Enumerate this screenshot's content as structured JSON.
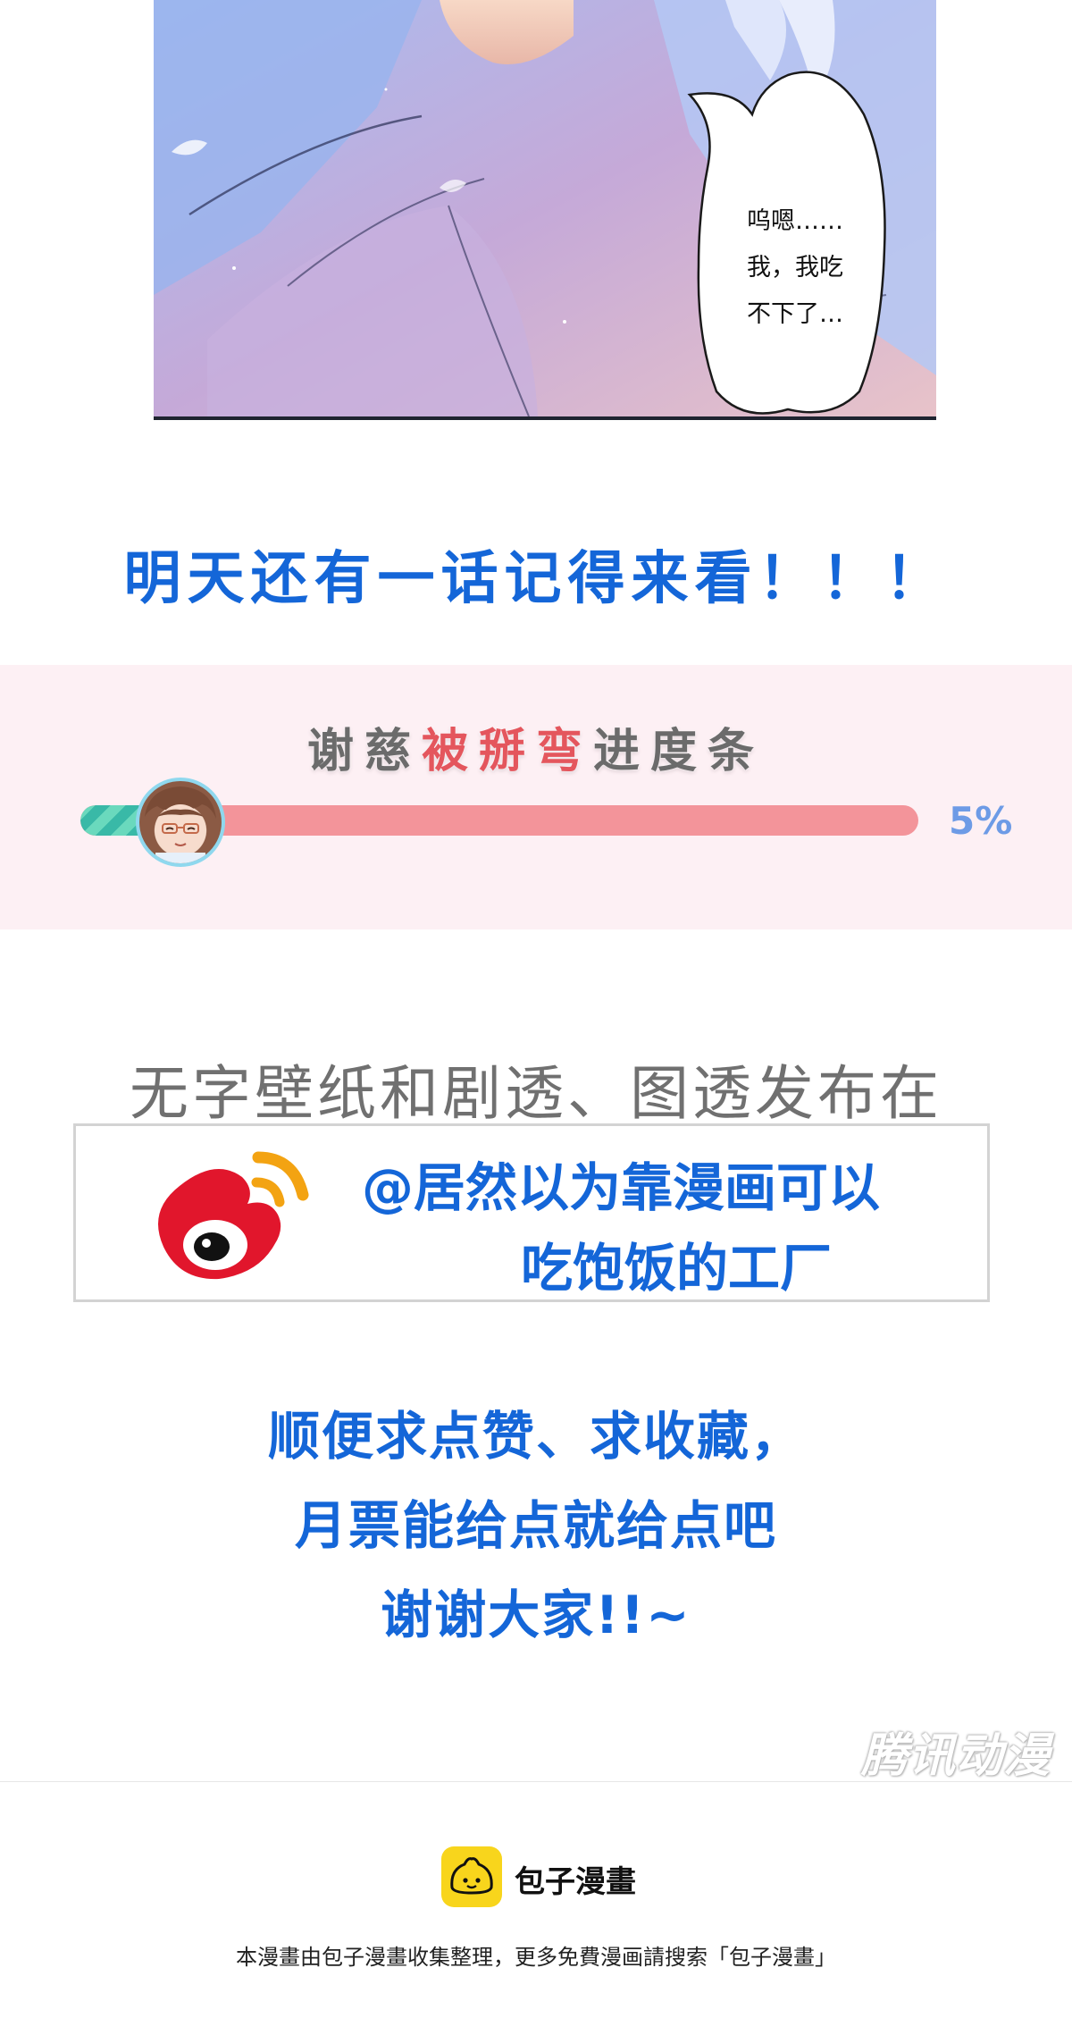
{
  "panel": {
    "speech_lines": [
      "呜嗯……",
      "我，我吃",
      "不下了…"
    ]
  },
  "reminder": "明天还有一话记得来看！！！",
  "progress": {
    "title_prefix": "谢慈",
    "title_highlight": "被掰弯",
    "title_suffix": "进度条",
    "percent_label": "5%",
    "value_fraction": 0.05
  },
  "sns": {
    "intro": "无字壁纸和剧透、图透发布在",
    "account_line1": "@居然以为靠漫画可以",
    "account_line2": "吃饱饭的工厂"
  },
  "ask": {
    "line1": "顺便求点赞、求收藏，",
    "line2": "月票能给点就给点吧",
    "line3": "谢谢大家!!~"
  },
  "watermark": "腾讯动漫",
  "footer": {
    "brand": "包子漫畫",
    "note": "本漫畫由包子漫畫收集整理，更多免費漫画請搜索「包子漫畫」"
  },
  "colors": {
    "accent_blue": "#1466d8",
    "highlight_red": "#e4565d",
    "progress_track": "#f3949a",
    "progress_fill": "#39b9a7",
    "percent_blue": "#6d9be6",
    "logo_yellow": "#f8d51c"
  },
  "icons": {
    "weibo": "weibo-logo-icon",
    "baozi": "baozi-logo-icon"
  }
}
